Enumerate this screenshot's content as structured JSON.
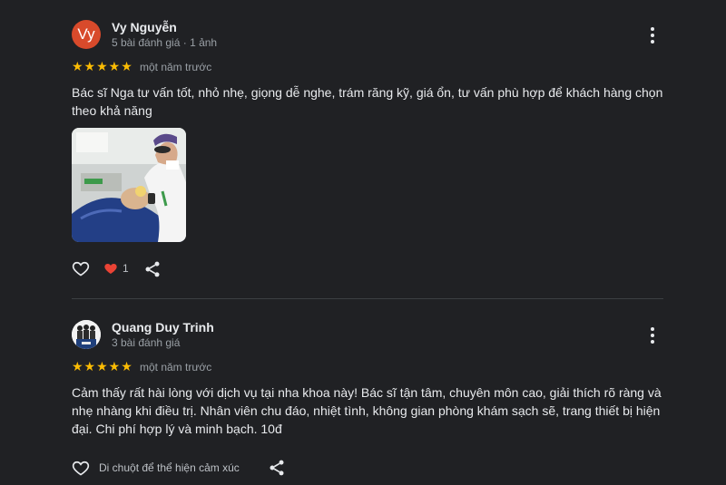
{
  "reviews": [
    {
      "avatar_text": "Vy",
      "avatar_color": "#d84a2b",
      "name": "Vy Nguyễn",
      "meta": "5 bài đánh giá · 1 ảnh",
      "rating": 5,
      "stars": "★★★★★",
      "time": "một năm trước",
      "text": "Bác sĩ Nga tư vấn tốt, nhỏ nhẹ, giọng dễ nghe, trám răng kỹ, giá ổn, tư vấn phù hợp để khách hàng chọn theo khả năng",
      "photo_icon": "dentist-photo",
      "reaction_count": "1",
      "icons": [
        "heart-outline-icon",
        "heart-filled-icon",
        "share-icon",
        "more-vert-icon"
      ]
    },
    {
      "avatar_icon": "group-photo-avatar",
      "name": "Quang Duy Trinh",
      "meta": "3 bài đánh giá",
      "rating": 5,
      "stars": "★★★★★",
      "time": "một năm trước",
      "text": "Cảm thấy rất hài lòng với dịch vụ tại nha khoa này! Bác sĩ tận tâm, chuyên môn cao, giải thích rõ ràng và nhẹ nhàng khi điều trị. Nhân viên chu đáo, nhiệt tình, không gian phòng khám sạch sẽ, trang thiết bị hiện đại. Chi phí hợp lý và minh bạch. 10đ",
      "react_hint": "Di chuột để thể hiện cảm xúc",
      "icons": [
        "heart-outline-icon",
        "share-icon",
        "more-vert-icon"
      ]
    }
  ],
  "colors": {
    "background": "#202124",
    "star": "#fbbc04",
    "heart": "#ea4335",
    "text": "#e8eaed",
    "secondary": "#9aa0a6"
  }
}
